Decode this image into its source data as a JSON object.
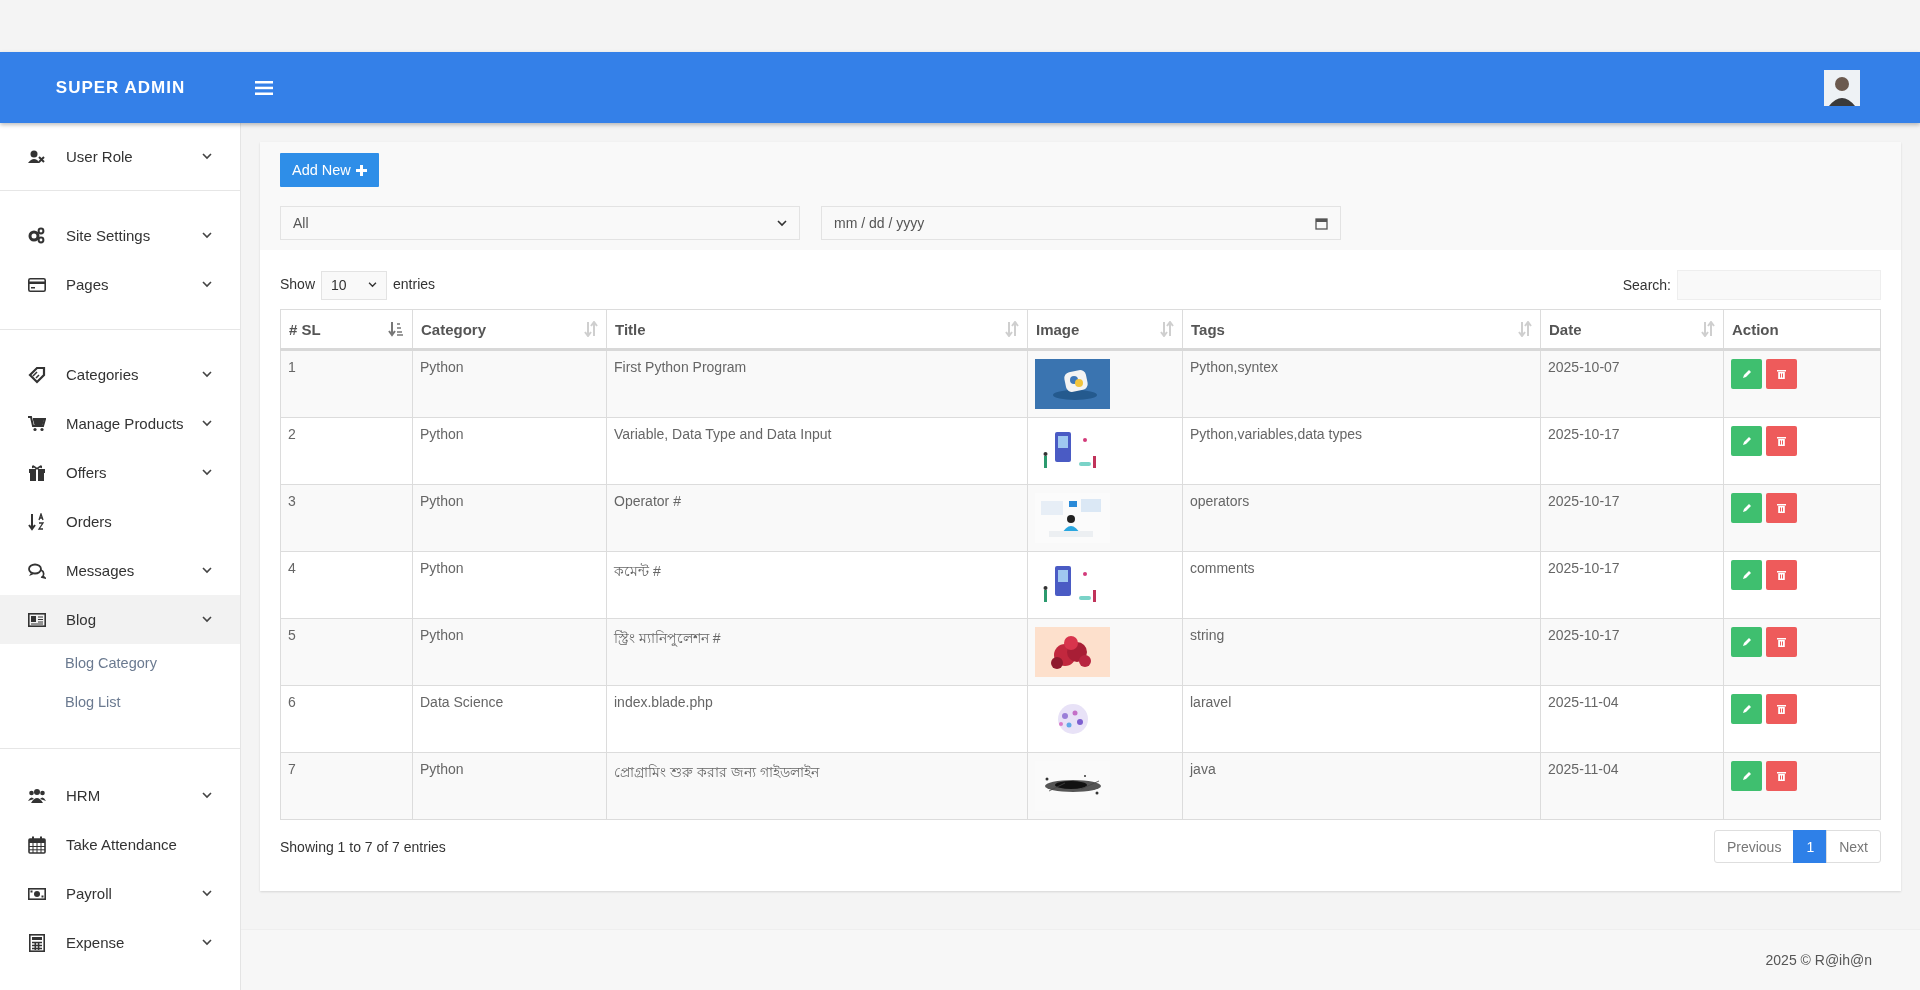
{
  "header": {
    "brand": "SUPER ADMIN"
  },
  "sidebar": {
    "groups": [
      {
        "items": [
          {
            "label": "User Role",
            "caret": true,
            "selected": false
          }
        ]
      },
      {
        "items": [
          {
            "label": "Site Settings",
            "caret": true,
            "selected": false
          },
          {
            "label": "Pages",
            "caret": true,
            "selected": false
          }
        ]
      },
      {
        "items": [
          {
            "label": "Categories",
            "caret": true,
            "selected": false
          },
          {
            "label": "Manage Products",
            "caret": true,
            "selected": false
          },
          {
            "label": "Offers",
            "caret": true,
            "selected": false
          },
          {
            "label": "Orders",
            "caret": false,
            "selected": false
          },
          {
            "label": "Messages",
            "caret": true,
            "selected": false
          },
          {
            "label": "Blog",
            "caret": true,
            "selected": true,
            "children": [
              {
                "label": "Blog Category"
              },
              {
                "label": "Blog List"
              }
            ]
          }
        ]
      },
      {
        "items": [
          {
            "label": "HRM",
            "caret": true,
            "selected": false
          },
          {
            "label": "Take Attendance",
            "caret": false,
            "selected": false
          },
          {
            "label": "Payroll",
            "caret": true,
            "selected": false
          },
          {
            "label": "Expense",
            "caret": true,
            "selected": false
          }
        ]
      }
    ]
  },
  "toolbar": {
    "add_button": "Add New",
    "filter_select": "All",
    "date_field": {
      "placeholder": "mm / dd / yyyy"
    }
  },
  "table_controls": {
    "show_label": "Show",
    "page_length": "10",
    "entries_label": "entries",
    "search_label": "Search:"
  },
  "table": {
    "columns": [
      {
        "label": "# SL",
        "sortable": true,
        "sorted": true
      },
      {
        "label": "Category",
        "sortable": true,
        "sorted": false
      },
      {
        "label": "Title",
        "sortable": true,
        "sorted": false
      },
      {
        "label": "Image",
        "sortable": true,
        "sorted": false
      },
      {
        "label": "Tags",
        "sortable": true,
        "sorted": false
      },
      {
        "label": "Date",
        "sortable": true,
        "sorted": false
      },
      {
        "label": "Action",
        "sortable": false,
        "sorted": false
      }
    ],
    "rows": [
      {
        "sl": "1",
        "category": "Python",
        "title": "First Python Program",
        "tags": "Python,syntex",
        "date": "2025-10-07"
      },
      {
        "sl": "2",
        "category": "Python",
        "title": "Variable, Data Type and Data Input",
        "tags": "Python,variables,data types",
        "date": "2025-10-17"
      },
      {
        "sl": "3",
        "category": "Python",
        "title": "Operator #",
        "tags": "operators",
        "date": "2025-10-17"
      },
      {
        "sl": "4",
        "category": "Python",
        "title": "কমেন্ট #",
        "tags": "comments",
        "date": "2025-10-17"
      },
      {
        "sl": "5",
        "category": "Python",
        "title": "স্ট্রিং ম্যানিপুলেশন #",
        "tags": "string",
        "date": "2025-10-17"
      },
      {
        "sl": "6",
        "category": "Data Science",
        "title": "index.blade.php",
        "tags": "laravel",
        "date": "2025-11-04"
      },
      {
        "sl": "7",
        "category": "Python",
        "title": "প্রোগ্রামিং শুরু করার জন্য গাইডলাইন",
        "tags": "java",
        "date": "2025-11-04"
      }
    ]
  },
  "table_info": "Showing 1 to 7 of 7 entries",
  "pagination": [
    {
      "label": "Previous",
      "selected": false
    },
    {
      "label": "1",
      "selected": true
    },
    {
      "label": "Next",
      "selected": false
    }
  ],
  "footer": "2025 © R@ih@n"
}
